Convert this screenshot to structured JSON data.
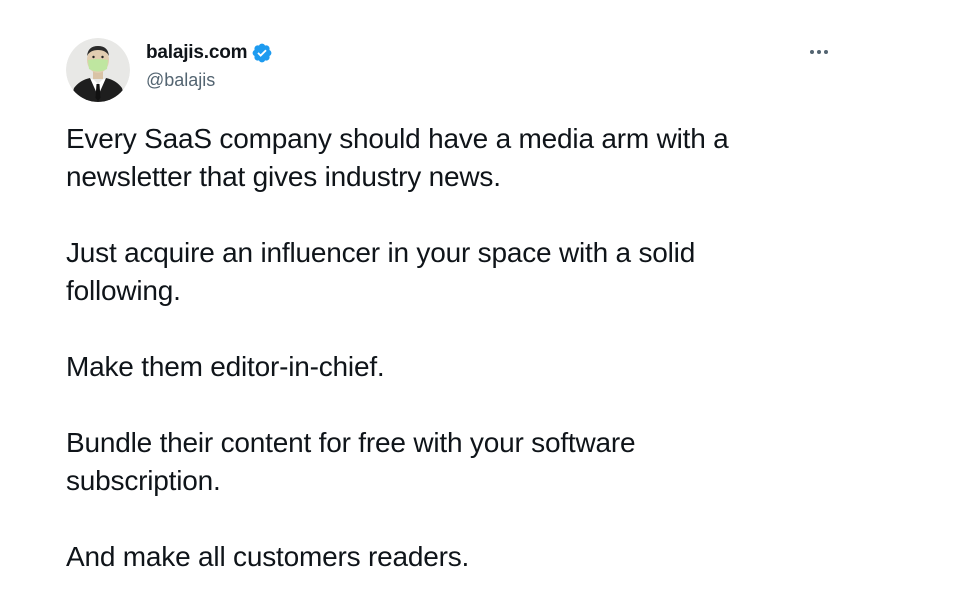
{
  "tweet": {
    "author": {
      "display_name": "balajis.com",
      "handle": "@balajis",
      "verified": true,
      "avatar_icon": "avatar-portrait-icon"
    },
    "menu_icon": "more-dots-icon",
    "paragraphs": [
      "Every SaaS company should have a media arm with a\nnewsletter that gives industry news.",
      "Just acquire an influencer in your space with a solid\nfollowing.",
      "Make them editor-in-chief.",
      "Bundle their content for free with your software\nsubscription.",
      "And make all customers readers."
    ]
  },
  "colors": {
    "text": "#0f1419",
    "secondary_text": "#536471",
    "verified_blue": "#1d9bf0",
    "background": "#ffffff"
  }
}
